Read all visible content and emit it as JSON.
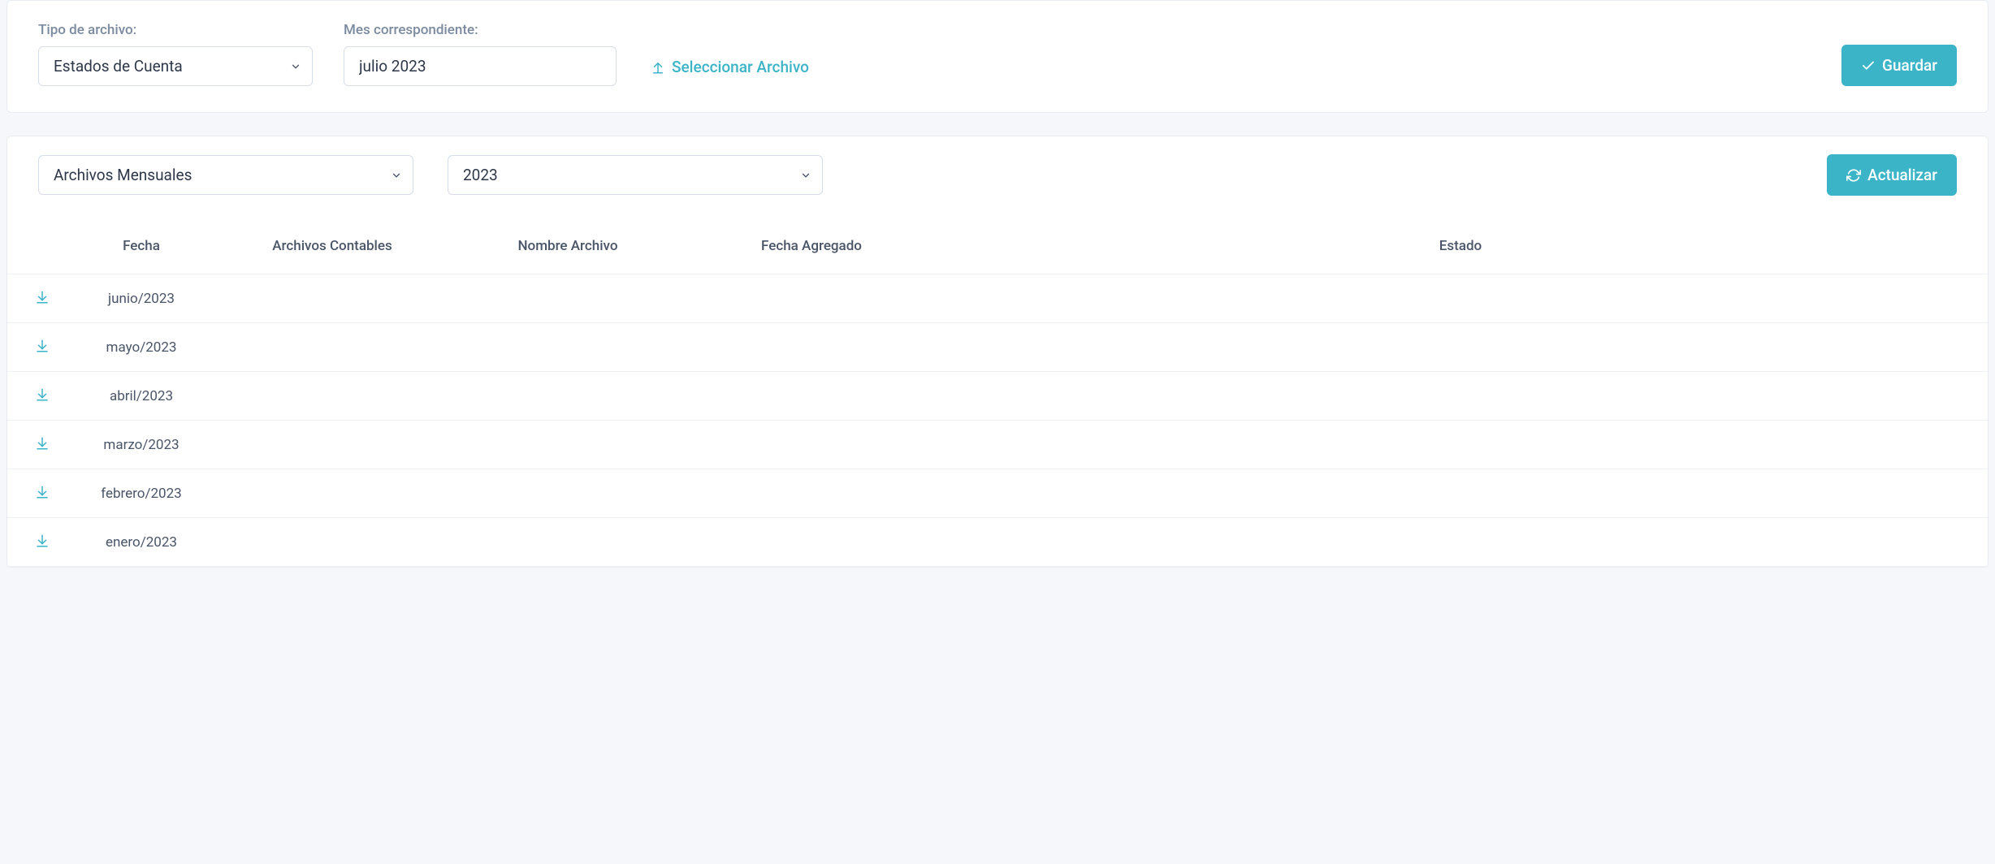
{
  "upload": {
    "tipo_label": "Tipo de archivo:",
    "tipo_value": "Estados de Cuenta",
    "mes_label": "Mes correspondiente:",
    "mes_value": "julio 2023",
    "select_file_label": "Seleccionar Archivo",
    "save_label": "Guardar"
  },
  "filters": {
    "category_value": "Archivos Mensuales",
    "year_value": "2023",
    "refresh_label": "Actualizar"
  },
  "table": {
    "headers": {
      "fecha": "Fecha",
      "contables": "Archivos Contables",
      "nombre": "Nombre Archivo",
      "agregado": "Fecha Agregado",
      "estado": "Estado"
    },
    "rows": [
      {
        "fecha": "junio/2023"
      },
      {
        "fecha": "mayo/2023"
      },
      {
        "fecha": "abril/2023"
      },
      {
        "fecha": "marzo/2023"
      },
      {
        "fecha": "febrero/2023"
      },
      {
        "fecha": "enero/2023"
      }
    ]
  }
}
